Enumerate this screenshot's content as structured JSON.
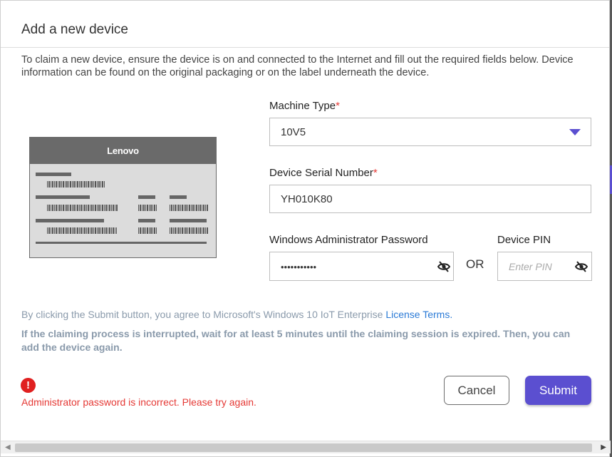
{
  "dialog": {
    "title": "Add a new device",
    "intro": "To claim a new device, ensure the device is on and connected to the Internet and fill out the required fields below. Device information can be found on the original packaging or on the label underneath the device."
  },
  "label_image": {
    "brand": "Lenovo"
  },
  "form": {
    "machine_type": {
      "label": "Machine Type",
      "required_mark": "*",
      "value": "10V5"
    },
    "serial": {
      "label": "Device Serial Number",
      "required_mark": "*",
      "value": "YH010K80"
    },
    "admin_password": {
      "label": "Windows Administrator Password",
      "value": "•••••••••••"
    },
    "or_label": "OR",
    "pin": {
      "label": "Device PIN",
      "placeholder": "Enter PIN"
    }
  },
  "agreement": {
    "text": "By clicking the Submit button, you agree to Microsoft's Windows 10 IoT Enterprise ",
    "link": "License Terms."
  },
  "warning": "If the claiming process is interrupted, wait for at least 5 minutes until the claiming session is expired. Then, you can add the device again.",
  "error": {
    "icon": "!",
    "message": "Administrator password is incorrect. Please try again."
  },
  "buttons": {
    "cancel": "Cancel",
    "submit": "Submit"
  },
  "scrollbar": {
    "left_arrow": "◀",
    "right_arrow": "▶"
  },
  "colors": {
    "accent": "#5b4fd0",
    "error": "#e53935",
    "link": "#2a7ad6"
  }
}
